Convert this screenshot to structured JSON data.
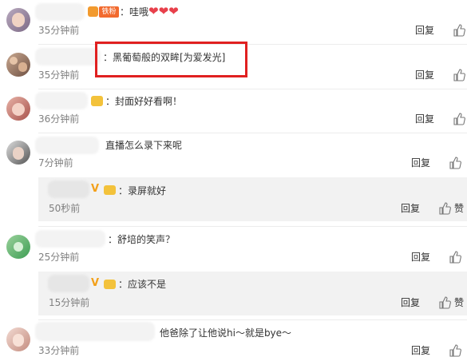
{
  "comments": [
    {
      "id": 1,
      "text": "：哇哦",
      "time": "35分钟前",
      "badge": "铁粉"
    },
    {
      "id": 2,
      "text": "：黑葡萄般的双眸[为爱发光]",
      "time": "35分钟前"
    },
    {
      "id": 3,
      "text": "：封面好好看啊！",
      "time": "36分钟前"
    },
    {
      "id": 4,
      "text": "直播怎么录下来呢",
      "time": "7分钟前"
    },
    {
      "id": 5,
      "text": "：录屏就好",
      "time": "50秒前"
    },
    {
      "id": 6,
      "text": "：舒培的笑声？",
      "time": "25分钟前"
    },
    {
      "id": 7,
      "text": "：应该不是",
      "time": "15分钟前"
    },
    {
      "id": 8,
      "text": "他爸除了让他说hi～就是bye～",
      "time": "33分钟前"
    }
  ],
  "actions": {
    "reply": "回复",
    "like": "赞"
  }
}
